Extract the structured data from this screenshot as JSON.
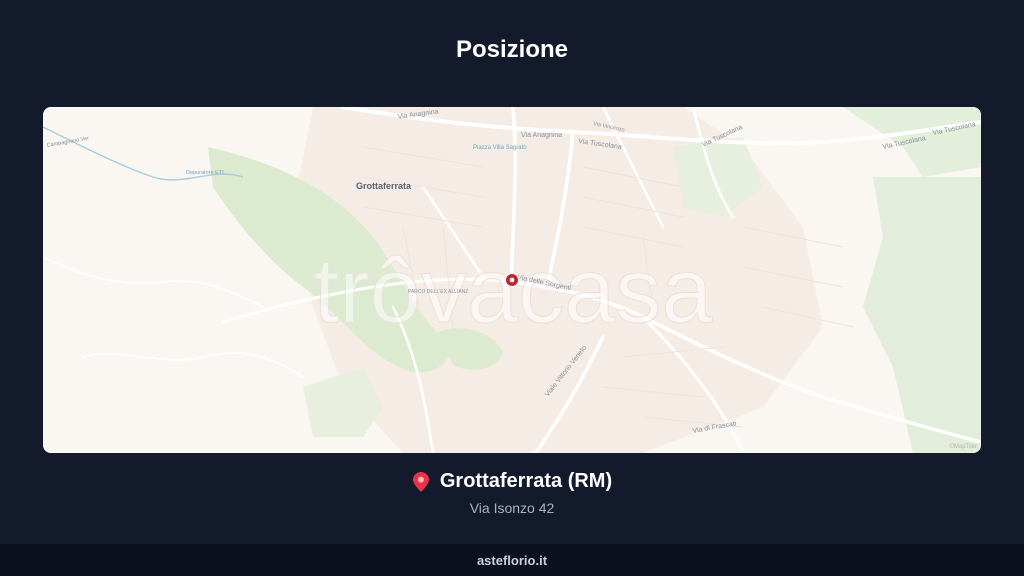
{
  "page": {
    "title": "Posizione"
  },
  "map": {
    "watermark": "trôvacasa",
    "attribution": "©MapTiler",
    "labels": {
      "city": "Grottaferrata",
      "via_anagnina_1": "Via Anagnina",
      "via_anagnina_2": "Via Anagnina",
      "via_tuscolana_1": "Via Tuscolana",
      "via_tuscolana_2": "Via Tuscolana",
      "via_tuscolana_3": "Via Tuscolana",
      "via_tuscolana_4": "Via Tuscolana",
      "via_delle_sorgenti": "Via delle Sorgenti",
      "viale_vittorio_veneto": "Viale Vittorio Veneto",
      "via_di_frascati": "Via di Frascati",
      "piazza": "Piazza Villa Sagrato",
      "pratone": "PARCO DELL'EX ALLIANZ",
      "depuratore": "Depuratore ETI",
      "via_vincenzo_lamberti": "Via Vincenzo",
      "campus": "Campagnano Ver"
    },
    "colors": {
      "land": "#faf6f1",
      "park": "#dcebcf",
      "road": "#ffffff",
      "water": "#a8cde0",
      "marker": "#c0232e"
    }
  },
  "location": {
    "icon": "map-pin-icon",
    "city": "Grottaferrata (RM)",
    "address": "Via Isonzo 42"
  },
  "footer": {
    "brand": "asteflorio.it"
  }
}
